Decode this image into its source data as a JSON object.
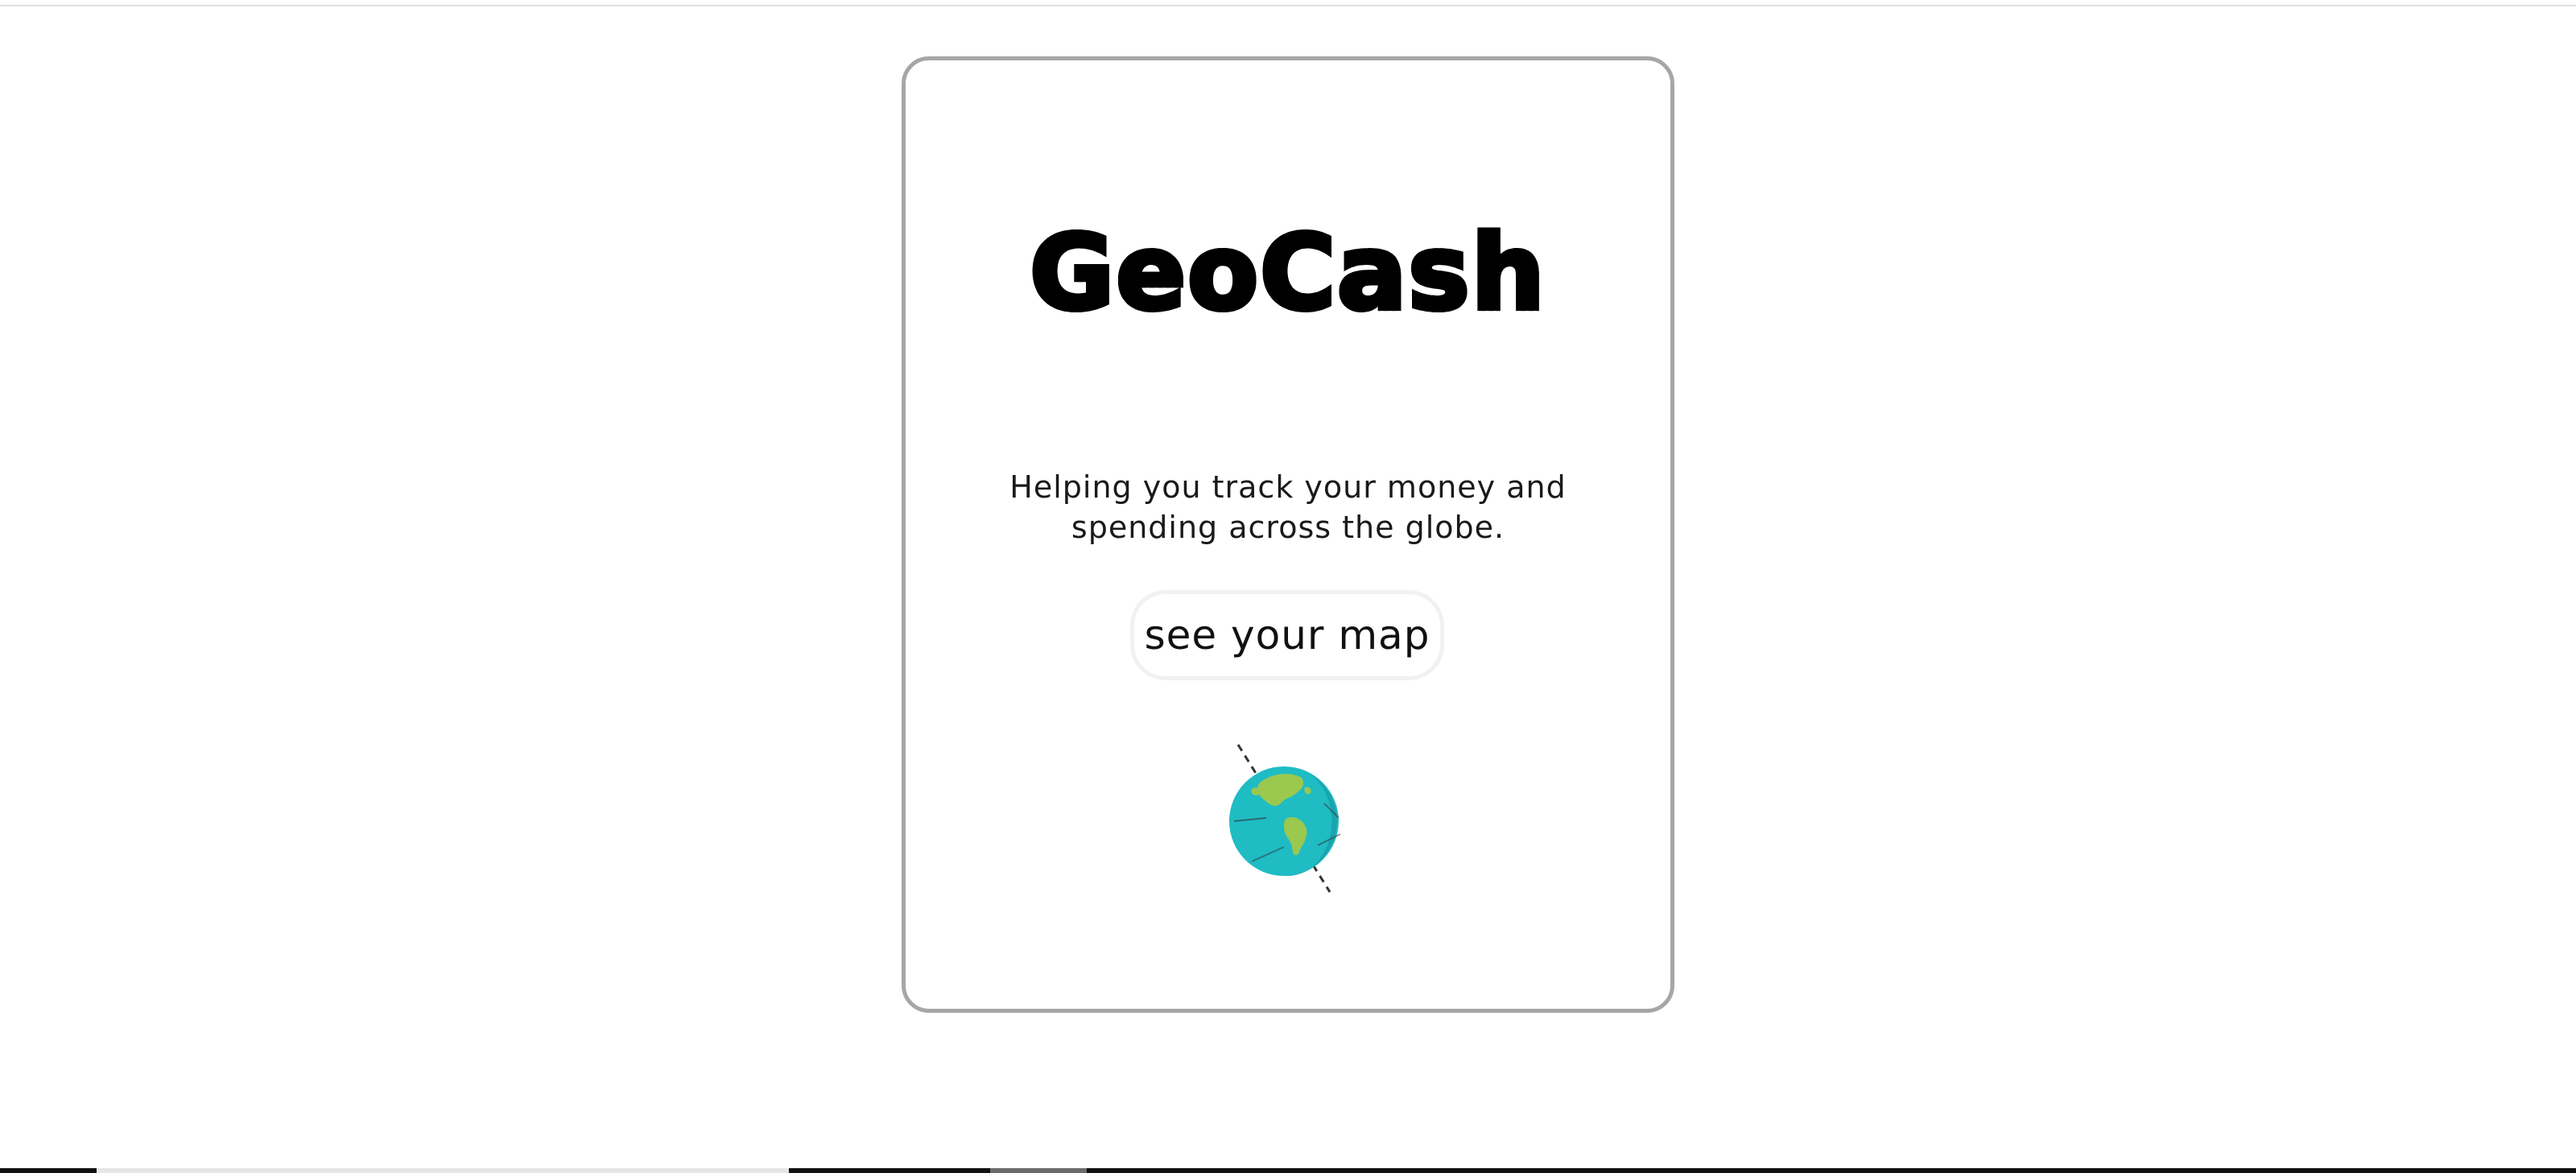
{
  "card": {
    "logo_text": "GeoCash",
    "tagline_line1": "Helping you track your money and",
    "tagline_line2": "spending across the globe.",
    "button_label": "see your map",
    "globe_icon": "globe-icon"
  },
  "colors": {
    "card_border": "#a6a6a6",
    "button_border": "#f1f1f1",
    "globe_ocean": "#1fbcc4",
    "globe_land": "#9bc84e"
  }
}
